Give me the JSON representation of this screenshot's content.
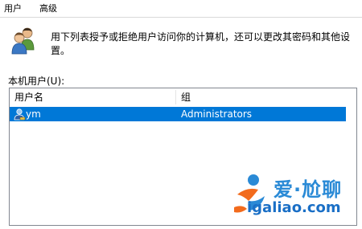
{
  "tabs": [
    {
      "label": "用户",
      "active": true
    },
    {
      "label": "高级",
      "active": false
    }
  ],
  "info": {
    "icon": "users-icon",
    "text": "用下列表授予或拒绝用户访问你的计算机，还可以更改其密码和其他设置。"
  },
  "local_users": {
    "label": "本机用户(U):",
    "columns": [
      "用户名",
      "组"
    ],
    "rows": [
      {
        "name": "ym",
        "group": "Administrators",
        "selected": true,
        "icon": "user-icon"
      }
    ]
  },
  "watermark": {
    "brand": "爱·尬聊",
    "url": "igaliao.com"
  },
  "colors": {
    "selection": "#0078d7",
    "watermark_orange": "#f26b1d",
    "watermark_blue": "#1a6fc6"
  }
}
